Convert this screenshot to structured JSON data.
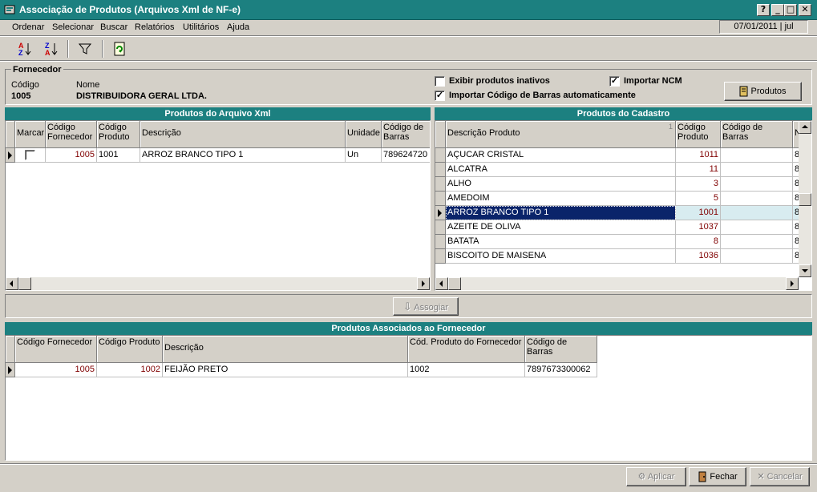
{
  "window": {
    "title": "Associação de Produtos (Arquivos Xml de NF-e)",
    "help": "?",
    "minimize": "_",
    "maximize": "□",
    "close": "✕"
  },
  "menu": [
    "Ordenar",
    "Selecionar",
    "Buscar",
    "Relatórios",
    "Utilitários",
    "Ajuda"
  ],
  "status_date": "07/01/2011 | jul",
  "fornecedor": {
    "group_label": "Fornecedor",
    "codigo_label": "Código",
    "codigo_value": "1005",
    "nome_label": "Nome",
    "nome_value": "DISTRIBUIDORA GERAL LTDA."
  },
  "options": {
    "exibir_inativos": {
      "label": "Exibir produtos inativos",
      "checked": false
    },
    "importar_ncm": {
      "label": "Importar NCM",
      "checked": true
    },
    "importar_barras": {
      "label": "Importar Código de Barras automaticamente",
      "checked": true
    },
    "produtos_button": "Produtos"
  },
  "xml_panel": {
    "title": "Produtos do Arquivo Xml",
    "columns": [
      "Marcar",
      "Código Fornecedor",
      "Código Produto",
      "Descrição",
      "Unidade",
      "Código de Barras"
    ],
    "rows": [
      {
        "marcar": false,
        "cod_fornecedor": "1005",
        "cod_produto": "1001",
        "descricao": "ARROZ BRANCO TIPO 1",
        "unidade": "Un",
        "barras": "789624720"
      }
    ]
  },
  "cadastro_panel": {
    "title": "Produtos do Cadastro",
    "columns": [
      "Descrição Produto",
      "Código Produto",
      "Código de Barras",
      "N"
    ],
    "sort_mark": "1",
    "rows": [
      {
        "descricao": "AÇUCAR CRISTAL",
        "codigo": "1011",
        "barras": "",
        "n": "8"
      },
      {
        "descricao": "ALCATRA",
        "codigo": "11",
        "barras": "",
        "n": "8"
      },
      {
        "descricao": "ALHO",
        "codigo": "3",
        "barras": "",
        "n": "8"
      },
      {
        "descricao": "AMEDOIM",
        "codigo": "5",
        "barras": "",
        "n": "8"
      },
      {
        "descricao": "ARROZ BRANCO TIPO 1",
        "codigo": "1001",
        "barras": "",
        "n": "8"
      },
      {
        "descricao": "AZEITE DE OLIVA",
        "codigo": "1037",
        "barras": "",
        "n": "8"
      },
      {
        "descricao": "BATATA",
        "codigo": "8",
        "barras": "",
        "n": "8"
      },
      {
        "descricao": "BISCOITO DE MAISENA",
        "codigo": "1036",
        "barras": "",
        "n": "8"
      }
    ],
    "selected_index": 4
  },
  "assoc_button": "Assogiar",
  "assoc_panel": {
    "title": "Produtos Associados ao Fornecedor",
    "columns": [
      "Código Fornecedor",
      "Código Produto",
      "Descrição",
      "Cód. Produto do Fornecedor",
      "Código de Barras"
    ],
    "rows": [
      {
        "cod_fornecedor": "1005",
        "cod_produto": "1002",
        "descricao": "FEIJÃO PRETO",
        "cod_prod_forn": "1002",
        "barras": "7897673300062"
      }
    ]
  },
  "footer": {
    "aplicar": "Aplicar",
    "fechar": "Fechar",
    "cancelar": "Cancelar"
  },
  "colors": {
    "title_bar": "#1c8080",
    "selection": "#0a246a",
    "code_red": "#800000"
  }
}
